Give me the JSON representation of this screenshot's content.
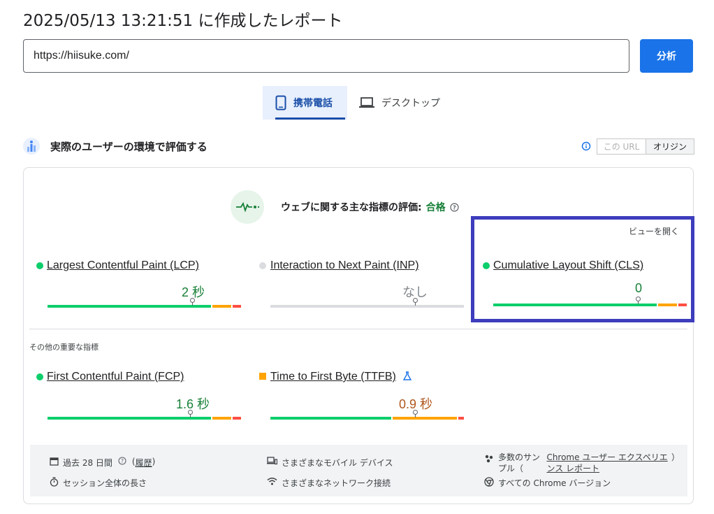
{
  "report_title": "2025/05/13 13:21:51 に作成したレポート",
  "url_input": {
    "value": "https://hiisuke.com/"
  },
  "analyze_label": "分析",
  "tabs": {
    "mobile": "携帯電話",
    "desktop": "デスクトップ"
  },
  "section": {
    "title": "実際のユーザーの環境で評価する",
    "toggle_this_url": "この URL",
    "toggle_origin": "オリジン"
  },
  "assessment": {
    "label": "ウェブに関する主な指標の評価:",
    "result": "合格"
  },
  "open_view": "ビューを開く",
  "core_metrics": [
    {
      "name": "Largest Contentful Paint (LCP)",
      "value": "2 秒",
      "status": "good",
      "marker": 0.75
    },
    {
      "name": "Interaction to Next Paint (INP)",
      "value": "なし",
      "status": "none",
      "marker": 0.75
    },
    {
      "name": "Cumulative Layout Shift (CLS)",
      "value": "0",
      "status": "good",
      "marker": 0.75
    }
  ],
  "other_title": "その他の重要な指標",
  "other_metrics": [
    {
      "name": "First Contentful Paint (FCP)",
      "value": "1.6 秒",
      "status": "good",
      "marker": 0.74
    },
    {
      "name": "Time to First Byte (TTFB)",
      "value": "0.9 秒",
      "status": "needs-improvement",
      "marker": 0.75
    }
  ],
  "colors": {
    "good": "#0cce6b",
    "needs_improvement": "#ffa400",
    "poor": "#ff4e42",
    "good_text": "#188038",
    "ni_text": "#b0561c",
    "none": "#dadce0",
    "accent": "#1a73e8"
  },
  "footer": {
    "period": "過去 28 日間",
    "history": "履歴",
    "devices": "さまざまなモバイル デバイス",
    "samples_prefix": "多数のサンプル（",
    "crux_link": "Chrome ユーザー エクスペリエンス レポート",
    "samples_suffix": "）",
    "session": "セッション全体の長さ",
    "network": "さまざまなネットワーク接続",
    "versions": "すべての Chrome バージョン"
  }
}
